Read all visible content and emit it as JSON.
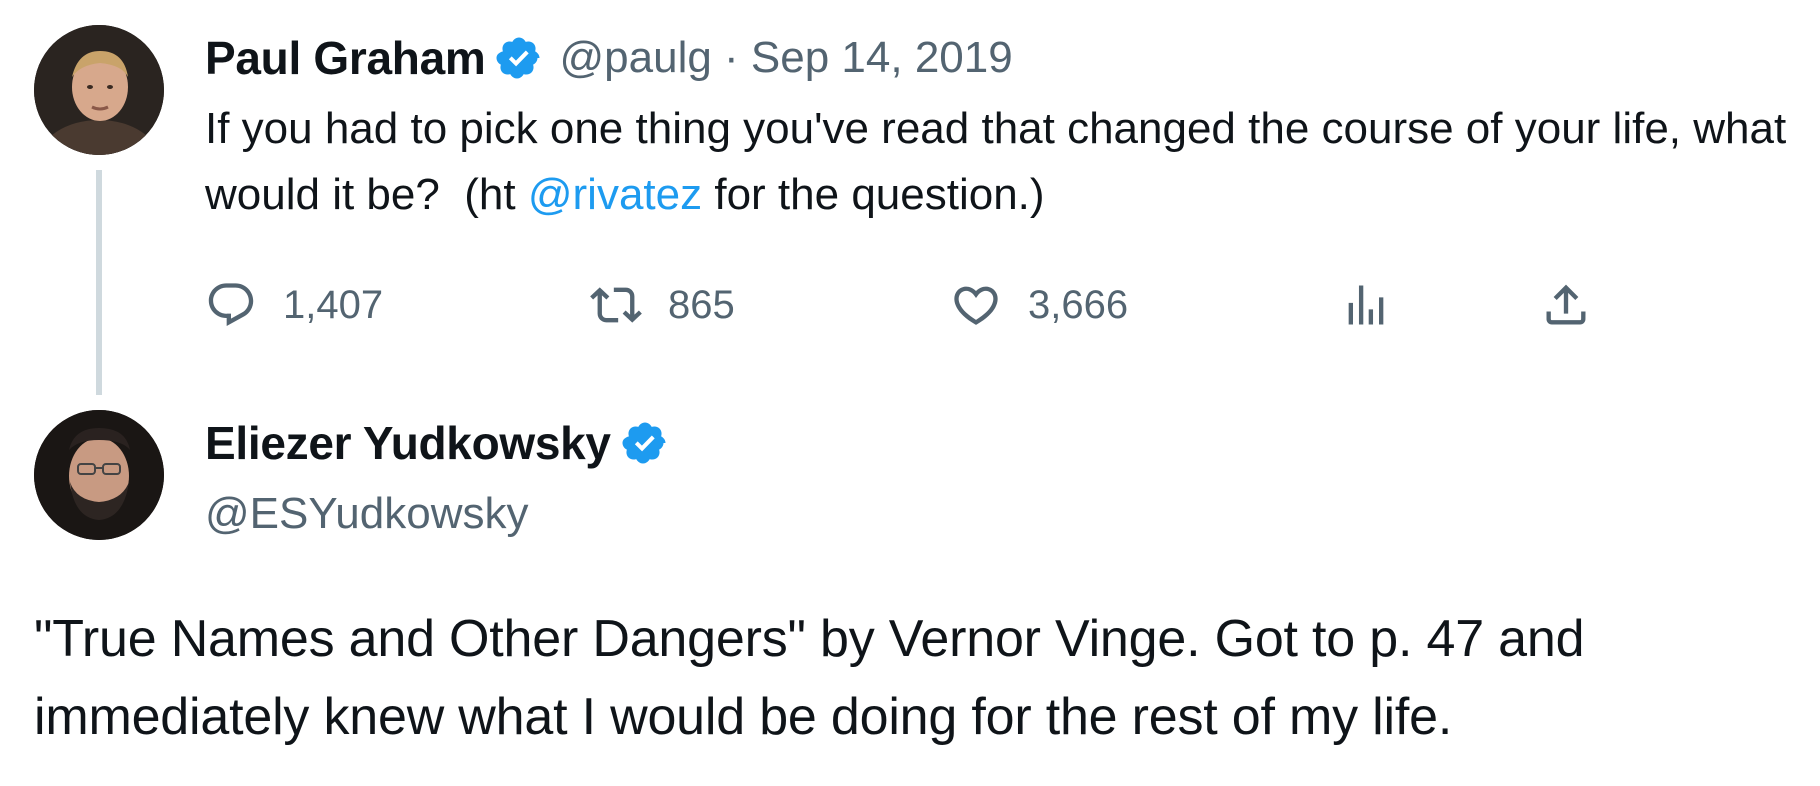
{
  "colors": {
    "text": "#0f1419",
    "secondary": "#536471",
    "accent": "#1d9bf0",
    "thread_line": "#cfd9de"
  },
  "tweet": {
    "author": {
      "name": "Paul Graham",
      "handle": "@paulg",
      "verified": true,
      "avatar_icon": "profile-photo"
    },
    "separator": " · ",
    "date": "Sep 14, 2019",
    "text_before": "If you had to pick one thing you've read that changed the course of your life, what would it be?  (ht ",
    "mention": "@rivatez",
    "text_after": " for the question.)",
    "actions": {
      "replies": "1,407",
      "retweets": "865",
      "likes": "3,666"
    }
  },
  "reply": {
    "author": {
      "name": "Eliezer Yudkowsky",
      "handle": "@ESYudkowsky",
      "verified": true,
      "avatar_icon": "profile-photo"
    },
    "text": "\"True Names and Other Dangers\" by Vernor Vinge. Got to p. 47 and immediately knew what I would be doing for the rest of my life."
  }
}
